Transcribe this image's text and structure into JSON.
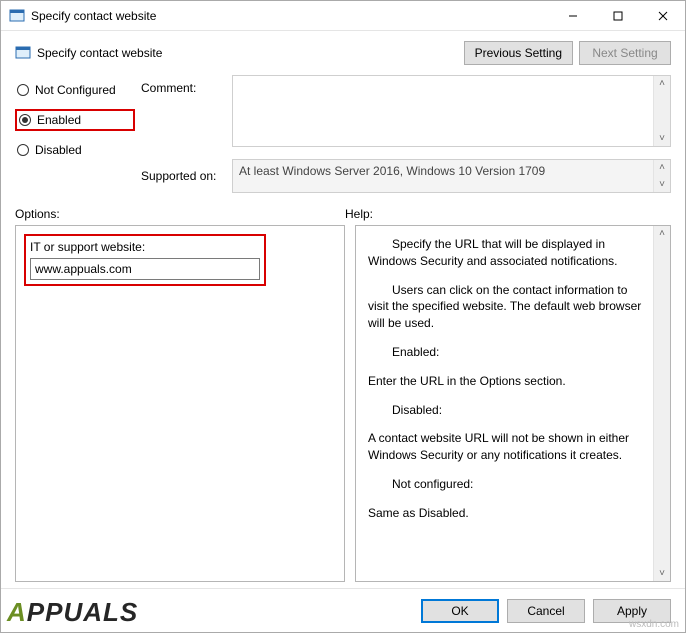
{
  "window": {
    "title": "Specify contact website"
  },
  "header": {
    "title": "Specify contact website",
    "previous_setting": "Previous Setting",
    "next_setting": "Next Setting"
  },
  "state": {
    "not_configured": "Not Configured",
    "enabled": "Enabled",
    "disabled": "Disabled",
    "selected": "enabled"
  },
  "labels": {
    "comment": "Comment:",
    "supported_on": "Supported on:",
    "options": "Options:",
    "help": "Help:"
  },
  "supported_on_text": "At least Windows Server 2016, Windows 10 Version 1709",
  "options": {
    "field_label": "IT or support website:",
    "field_value": "www.appuals.com"
  },
  "help": {
    "p1": "Specify the URL that will be displayed in Windows Security and associated notifications.",
    "p2": "Users can click on the contact information to visit the specified website. The default web browser will be used.",
    "p3a": "Enabled:",
    "p3b": "Enter the URL in the Options section.",
    "p4a": "Disabled:",
    "p4b": "A contact website URL will not be shown in either Windows Security or any notifications it creates.",
    "p5a": "Not configured:",
    "p5b": "Same as Disabled."
  },
  "footer": {
    "ok": "OK",
    "cancel": "Cancel",
    "apply": "Apply"
  },
  "watermark": "APPUALS",
  "source": "wsxdn.com"
}
